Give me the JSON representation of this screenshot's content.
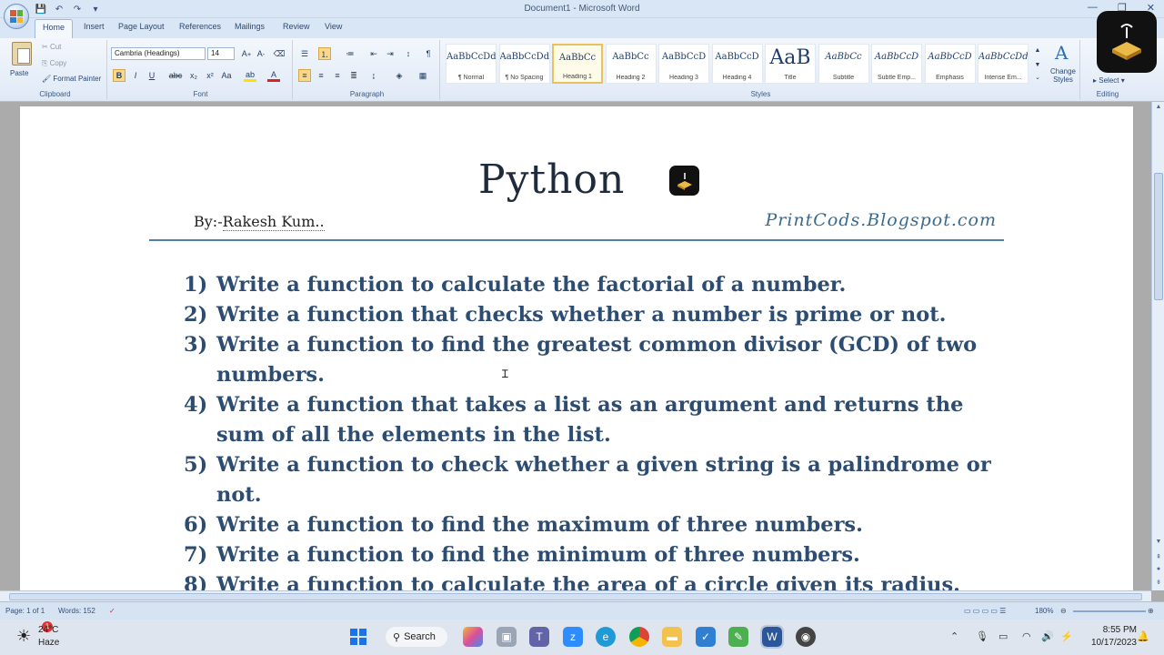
{
  "window": {
    "title": "Document1 - Microsoft Word",
    "minimize": "—",
    "restore": "❐",
    "close": "✕"
  },
  "tabs": [
    "Home",
    "Insert",
    "Page Layout",
    "References",
    "Mailings",
    "Review",
    "View"
  ],
  "ribbon": {
    "clipboard": {
      "paste": "Paste",
      "cut": "Cut",
      "copy": "Copy",
      "format_painter": "Format Painter",
      "label": "Clipboard"
    },
    "font": {
      "name": "Cambria (Headings)",
      "size": "14",
      "label": "Font"
    },
    "paragraph": {
      "label": "Paragraph"
    },
    "styles": {
      "label": "Styles",
      "items": [
        {
          "sample": "AaBbCcDd",
          "name": "¶ Normal"
        },
        {
          "sample": "AaBbCcDd",
          "name": "¶ No Spacing"
        },
        {
          "sample": "AaBbCc",
          "name": "Heading 1"
        },
        {
          "sample": "AaBbCc",
          "name": "Heading 2"
        },
        {
          "sample": "AaBbCcD",
          "name": "Heading 3"
        },
        {
          "sample": "AaBbCcD",
          "name": "Heading 4"
        },
        {
          "sample": "AaB",
          "name": "Title"
        },
        {
          "sample": "AaBbCc",
          "name": "Subtitle"
        },
        {
          "sample": "AaBbCcD",
          "name": "Subtle Emp..."
        },
        {
          "sample": "AaBbCcD",
          "name": "Emphasis"
        },
        {
          "sample": "AaBbCcDd",
          "name": "Intense Em..."
        }
      ],
      "change_styles": "Change Styles"
    },
    "editing": {
      "select": "Select",
      "label": "Editing"
    }
  },
  "document": {
    "title": "Python",
    "author_prefix": "By:-",
    "author_name": "Rakesh Kum..",
    "site": "PrintCods.Blogspot.com",
    "questions": [
      {
        "num": "1)",
        "lines": [
          "Write a function to calculate the factorial of a number."
        ]
      },
      {
        "num": "2)",
        "lines": [
          "Write a function that checks whether a number is prime or not."
        ]
      },
      {
        "num": "3)",
        "lines": [
          "Write a function to find the greatest common divisor (GCD) of two",
          "numbers."
        ]
      },
      {
        "num": "4)",
        "lines": [
          "Write a function that takes a list as an argument and returns the",
          "sum of all the elements in the list."
        ]
      },
      {
        "num": "5)",
        "lines": [
          "Write a function to check whether a given string is a palindrome or",
          "not."
        ]
      },
      {
        "num": "6)",
        "lines": [
          "Write a function to find the maximum of three numbers."
        ]
      },
      {
        "num": "7)",
        "lines": [
          "Write a function to find the minimum of three numbers."
        ]
      },
      {
        "num": "8)",
        "lines": [
          "Write a function to calculate the area of a circle given its radius."
        ]
      }
    ]
  },
  "status": {
    "page": "Page: 1 of 1",
    "words": "Words: 152",
    "zoom": "180%"
  },
  "taskbar": {
    "weather_temp": "24°C",
    "weather_desc": "Haze",
    "weather_badge": "1",
    "search": "Search",
    "time": "8:55 PM",
    "date": "10/17/2023"
  },
  "colors": {
    "accent": "#2c4c72",
    "rule": "#4f7ea6",
    "site": "#3a6a8f"
  }
}
